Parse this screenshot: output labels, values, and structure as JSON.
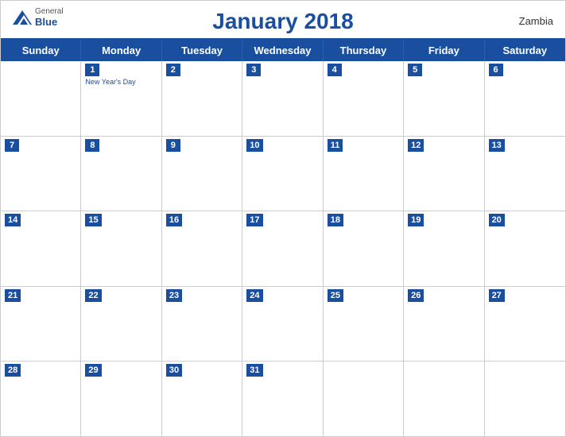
{
  "header": {
    "title": "January 2018",
    "country": "Zambia",
    "logo": {
      "general": "General",
      "blue": "Blue"
    }
  },
  "days_of_week": [
    "Sunday",
    "Monday",
    "Tuesday",
    "Wednesday",
    "Thursday",
    "Friday",
    "Saturday"
  ],
  "weeks": [
    [
      {
        "day": "",
        "holiday": ""
      },
      {
        "day": "1",
        "holiday": "New Year's Day"
      },
      {
        "day": "2",
        "holiday": ""
      },
      {
        "day": "3",
        "holiday": ""
      },
      {
        "day": "4",
        "holiday": ""
      },
      {
        "day": "5",
        "holiday": ""
      },
      {
        "day": "6",
        "holiday": ""
      }
    ],
    [
      {
        "day": "7",
        "holiday": ""
      },
      {
        "day": "8",
        "holiday": ""
      },
      {
        "day": "9",
        "holiday": ""
      },
      {
        "day": "10",
        "holiday": ""
      },
      {
        "day": "11",
        "holiday": ""
      },
      {
        "day": "12",
        "holiday": ""
      },
      {
        "day": "13",
        "holiday": ""
      }
    ],
    [
      {
        "day": "14",
        "holiday": ""
      },
      {
        "day": "15",
        "holiday": ""
      },
      {
        "day": "16",
        "holiday": ""
      },
      {
        "day": "17",
        "holiday": ""
      },
      {
        "day": "18",
        "holiday": ""
      },
      {
        "day": "19",
        "holiday": ""
      },
      {
        "day": "20",
        "holiday": ""
      }
    ],
    [
      {
        "day": "21",
        "holiday": ""
      },
      {
        "day": "22",
        "holiday": ""
      },
      {
        "day": "23",
        "holiday": ""
      },
      {
        "day": "24",
        "holiday": ""
      },
      {
        "day": "25",
        "holiday": ""
      },
      {
        "day": "26",
        "holiday": ""
      },
      {
        "day": "27",
        "holiday": ""
      }
    ],
    [
      {
        "day": "28",
        "holiday": ""
      },
      {
        "day": "29",
        "holiday": ""
      },
      {
        "day": "30",
        "holiday": ""
      },
      {
        "day": "31",
        "holiday": ""
      },
      {
        "day": "",
        "holiday": ""
      },
      {
        "day": "",
        "holiday": ""
      },
      {
        "day": "",
        "holiday": ""
      }
    ]
  ],
  "colors": {
    "primary": "#1a4fa0",
    "header_text": "#ffffff",
    "border": "#cccccc"
  }
}
